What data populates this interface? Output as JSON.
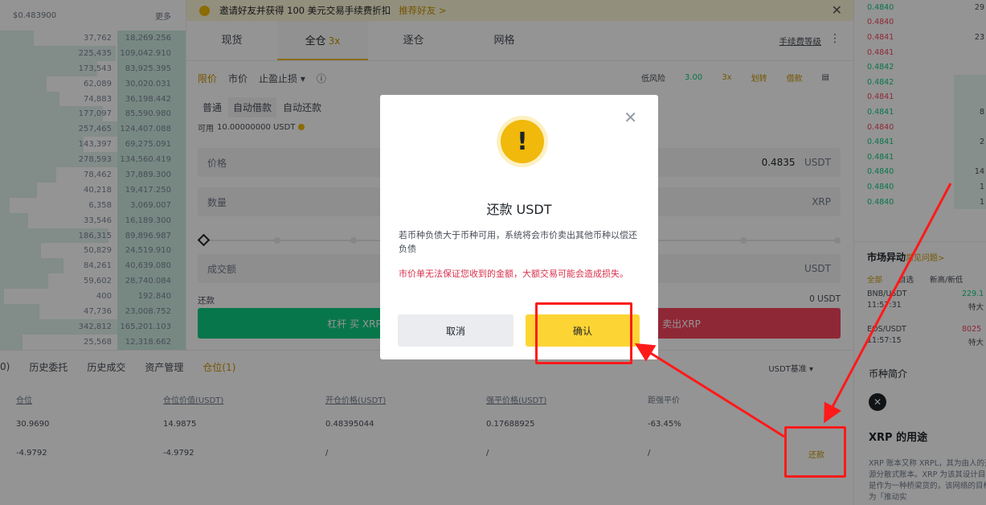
{
  "orderbook": {
    "price_header": "$0.483900",
    "more": "更多",
    "rows": [
      {
        "q": "37,762",
        "t": "18,269.256",
        "b": 0.18
      },
      {
        "q": "225,435",
        "t": "109,042.910",
        "b": 0.62
      },
      {
        "q": "173,543",
        "t": "83,925.395",
        "b": 0.52
      },
      {
        "q": "62,089",
        "t": "30,020.031",
        "b": 0.25
      },
      {
        "q": "74,883",
        "t": "36,198.442",
        "b": 0.32
      },
      {
        "q": "177,097",
        "t": "85,590.980",
        "b": 0.55
      },
      {
        "q": "257,465",
        "t": "124,407.088",
        "b": 0.72
      },
      {
        "q": "143,397",
        "t": "69,275.091",
        "b": 0.45
      },
      {
        "q": "278,593",
        "t": "134,560.419",
        "b": 0.8
      },
      {
        "q": "78,462",
        "t": "37,889.300",
        "b": 0.3
      },
      {
        "q": "40,218",
        "t": "19,417.250",
        "b": 0.2
      },
      {
        "q": "6,358",
        "t": "3,069.007",
        "b": 0.05
      },
      {
        "q": "33,546",
        "t": "16,189.300",
        "b": 0.15
      },
      {
        "q": "186,315",
        "t": "89,896.987",
        "b": 0.58
      },
      {
        "q": "50,829",
        "t": "24,519.910",
        "b": 0.22
      },
      {
        "q": "84,261",
        "t": "40,639.080",
        "b": 0.34
      },
      {
        "q": "59,602",
        "t": "28,740.084",
        "b": 0.26
      },
      {
        "q": "400",
        "t": "192.840",
        "b": 0.02
      },
      {
        "q": "47,736",
        "t": "23,008.752",
        "b": 0.21
      },
      {
        "q": "342,812",
        "t": "165,201.103",
        "b": 0.95
      },
      {
        "q": "25,568",
        "t": "12,318.662",
        "b": 0.12
      }
    ]
  },
  "banner": {
    "text": "邀请好友并获得 100 美元交易手续费折扣",
    "link": "推荐好友 >",
    "close": "✕"
  },
  "tabs": [
    {
      "label": "现货",
      "lev": ""
    },
    {
      "label": "全仓",
      "lev": "3x"
    },
    {
      "label": "逐仓",
      "lev": ""
    },
    {
      "label": "网格",
      "lev": ""
    }
  ],
  "fee_rate": "手续费等级",
  "kebab": "⋮",
  "order_types": {
    "limit": "限价",
    "market": "市价",
    "stop": "止盈止损 ▾",
    "info": "ⓘ"
  },
  "risk": {
    "label": "低风险",
    "value": "3.00",
    "lev": "3x",
    "borrow": "划转",
    "repay": "借款",
    "calc": "▤"
  },
  "mode": {
    "normal": "普通",
    "auto_borrow": "自动借款",
    "auto_repay": "自动还款"
  },
  "avail": {
    "label": "可用",
    "value": "10.00000000 USDT"
  },
  "fields": {
    "price": {
      "label": "价格",
      "value": "0.4835",
      "unit": "USDT"
    },
    "qty": {
      "label": "数量",
      "unit": "XRP"
    },
    "total": {
      "label": "成交额",
      "unit": "USDT"
    }
  },
  "repay_row": {
    "label": "还款",
    "value": "0 USDT"
  },
  "buy_label": "杠杆 买 XRP",
  "sell_label": "卖出XRP",
  "bottom_tabs": [
    "0)",
    "历史委托",
    "历史成交",
    "资产管理",
    "仓位(1)"
  ],
  "unit_label": "USDT基准 ▾",
  "positions": {
    "headers": [
      "仓位",
      "仓位价值(USDT)",
      "开仓价格(USDT)",
      "强平价格(USDT)",
      "距强平价"
    ],
    "rows": [
      [
        "30.9690",
        "14.9875",
        "0.48395044",
        "0.17688925",
        "-63.45%"
      ],
      [
        "-4.9792",
        "-4.9792",
        "/",
        "/",
        "/"
      ]
    ],
    "repay_link": "还款"
  },
  "right_book": [
    {
      "p": "0.4840",
      "a": "29",
      "d": "up"
    },
    {
      "p": "0.4840",
      "a": "",
      "d": "dn"
    },
    {
      "p": "0.4841",
      "a": "23",
      "d": "dn"
    },
    {
      "p": "0.4841",
      "a": "",
      "d": "dn"
    },
    {
      "p": "0.4842",
      "a": "",
      "d": "up"
    },
    {
      "p": "0.4842",
      "a": "",
      "d": "up"
    },
    {
      "p": "0.4841",
      "a": "",
      "d": "dn"
    },
    {
      "p": "0.4841",
      "a": "8",
      "d": "up"
    },
    {
      "p": "0.4840",
      "a": "",
      "d": "dn"
    },
    {
      "p": "0.4841",
      "a": "2",
      "d": "up"
    },
    {
      "p": "0.4841",
      "a": "",
      "d": "up"
    },
    {
      "p": "0.4840",
      "a": "14",
      "d": "up"
    },
    {
      "p": "0.4840",
      "a": "1",
      "d": "up"
    },
    {
      "p": "0.4840",
      "a": "1",
      "d": "up"
    }
  ],
  "movers": {
    "title": "市场异动",
    "faq": "常见问题>",
    "tabs": [
      "全部",
      "自选",
      "新高/新低"
    ],
    "items": [
      {
        "sym": "BNB/USDT",
        "time": "11:57:31",
        "chg": "229.1",
        "lab": "特大",
        "red": false
      },
      {
        "sym": "EOS/USDT",
        "time": "11:57:15",
        "chg": "8025",
        "lab": "特大",
        "red": true
      }
    ]
  },
  "coin": {
    "title": "币种简介",
    "logo": "✕",
    "name": "XRP 的用途",
    "desc": "XRP 账本又称 XRPL，其为由人的开源分散式账本。XRP 为该其设计目的是作为一种桥梁货的，该网络的目标为「推动实"
  },
  "modal": {
    "icon": "!",
    "title": "还款 USDT",
    "desc": "若币种负债大于币种可用，系统将会市价卖出其他币种以偿还负债",
    "warn": "市价单无法保证您收到的金额，大额交易可能会造成损失。",
    "cancel": "取消",
    "confirm": "确认",
    "close": "✕"
  },
  "colors": {
    "accent": "#f0b90b",
    "buy": "#0ecb81",
    "sell": "#f6465d",
    "annotation": "#ff1a1a"
  }
}
